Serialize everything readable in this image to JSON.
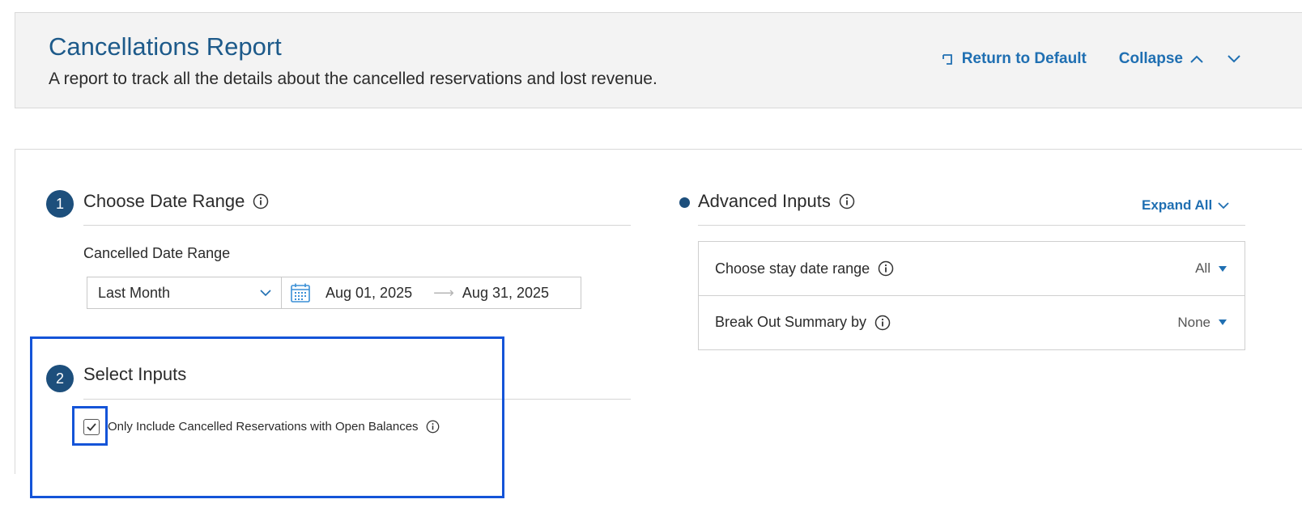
{
  "header": {
    "title": "Cancellations Report",
    "subtitle": "A report to track all the details about the cancelled reservations and lost revenue.",
    "return_label": "Return to Default",
    "collapse_label": "Collapse"
  },
  "step1": {
    "number": "1",
    "title": "Choose Date Range",
    "field_label": "Cancelled Date Range",
    "range_value": "Last Month",
    "start_date": "Aug 01, 2025",
    "end_date": "Aug 31, 2025"
  },
  "step2": {
    "number": "2",
    "title": "Select Inputs",
    "checkbox_label": "Only Include Cancelled Reservations with Open Balances",
    "checkbox_checked": true
  },
  "advanced": {
    "title": "Advanced Inputs",
    "expand_label": "Expand All",
    "rows": [
      {
        "label": "Choose stay date range",
        "value": "All"
      },
      {
        "label": "Break Out Summary by",
        "value": "None"
      }
    ]
  },
  "colors": {
    "accent": "#1f6fb2",
    "step_badge": "#1d4f7c",
    "highlight": "#1454d8"
  }
}
